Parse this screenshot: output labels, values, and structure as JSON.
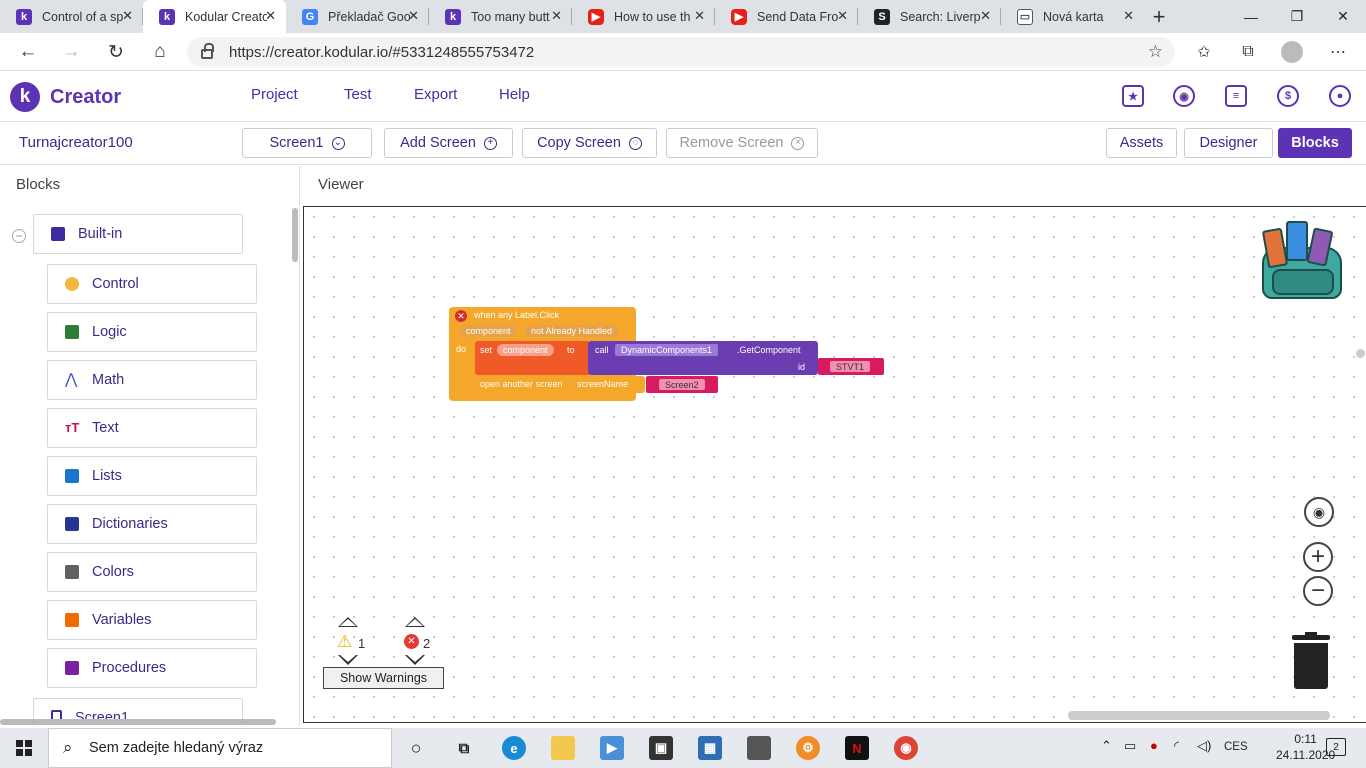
{
  "browser": {
    "tabs": [
      {
        "title": "Control of a sp",
        "icon": "kodular-icon",
        "color": "#5c33b4"
      },
      {
        "title": "Kodular Creato",
        "icon": "kodular-icon",
        "color": "#5c33b4",
        "active": true
      },
      {
        "title": "Překladač Goo",
        "icon": "google-translate-icon",
        "color": "#4285f4"
      },
      {
        "title": "Too many butt",
        "icon": "kodular-icon",
        "color": "#5c33b4"
      },
      {
        "title": "How to use th",
        "icon": "youtube-icon",
        "color": "#e62117"
      },
      {
        "title": "Send Data Fro",
        "icon": "youtube-icon",
        "color": "#e62117"
      },
      {
        "title": "Search: Liverp",
        "icon": "search-s-icon",
        "color": "#222222"
      },
      {
        "title": "Nová karta",
        "icon": "new-tab-icon",
        "color": "#555555"
      }
    ],
    "new_tab": "+",
    "url": "https://creator.kodular.io/#5331248555753472"
  },
  "app": {
    "logo_letter": "k",
    "name": "Creator",
    "menu": [
      "Project",
      "Test",
      "Export",
      "Help"
    ],
    "project_name": "Turnajcreator100",
    "screen_select": "Screen1",
    "add_screen": "Add Screen",
    "copy_screen": "Copy Screen",
    "remove_screen": "Remove Screen",
    "assets": "Assets",
    "designer": "Designer",
    "blocks": "Blocks",
    "accent": "#5c33b4"
  },
  "left": {
    "header": "Blocks",
    "builtin": "Built-in",
    "items": [
      {
        "label": "Control",
        "color": "#f4b63f"
      },
      {
        "label": "Logic",
        "color": "#2e7d32"
      },
      {
        "label": "Math",
        "color": "#3f51b5"
      },
      {
        "label": "Text",
        "color": "#c2185b"
      },
      {
        "label": "Lists",
        "color": "#1976d2"
      },
      {
        "label": "Dictionaries",
        "color": "#283593"
      },
      {
        "label": "Colors",
        "color": "#616161"
      },
      {
        "label": "Variables",
        "color": "#ef6c00"
      },
      {
        "label": "Procedures",
        "color": "#7b1fa2"
      }
    ],
    "screen_item": "Screen1"
  },
  "viewer": {
    "header": "Viewer",
    "event": {
      "title": "when any Label.Click",
      "param1": "component",
      "param2": "not Already Handled",
      "do": "do"
    },
    "set": {
      "set": "set",
      "var": "component",
      "to": "to"
    },
    "call": {
      "call": "call",
      "component": "DynamicComponents1",
      "method": ".GetComponent",
      "id": "id",
      "id_value": "STVT1"
    },
    "open": {
      "label": "open another screen",
      "param": "screenName",
      "value": "Screen2"
    },
    "warnings_count": "1",
    "errors_count": "2",
    "show_warnings": "Show Warnings"
  },
  "taskbar": {
    "search_placeholder": "Sem zadejte hledaný výraz",
    "lang": "CES",
    "time": "0:11",
    "date": "24.11.2020",
    "notif_count": "2"
  }
}
